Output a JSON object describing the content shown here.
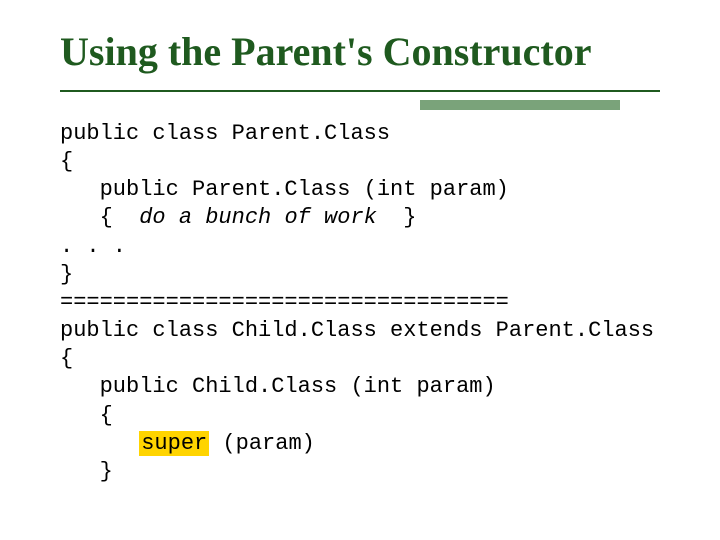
{
  "title": "Using the Parent's Constructor",
  "code": {
    "l1": "public class Parent.Class",
    "l2": "{",
    "l3a": "   public Parent.Class (int param)",
    "l4a": "   {  ",
    "l4b": "do a bunch of work",
    "l4c": "  }",
    "l5": ". . .",
    "l6": "}",
    "l7": "==================================",
    "l8": "public class Child.Class extends Parent.Class",
    "l9": "{",
    "l10": "   public Child.Class (int param)",
    "l11": "   {",
    "l12a": "      ",
    "l12b": "super",
    "l12c": " (param)",
    "l13": "   }"
  }
}
